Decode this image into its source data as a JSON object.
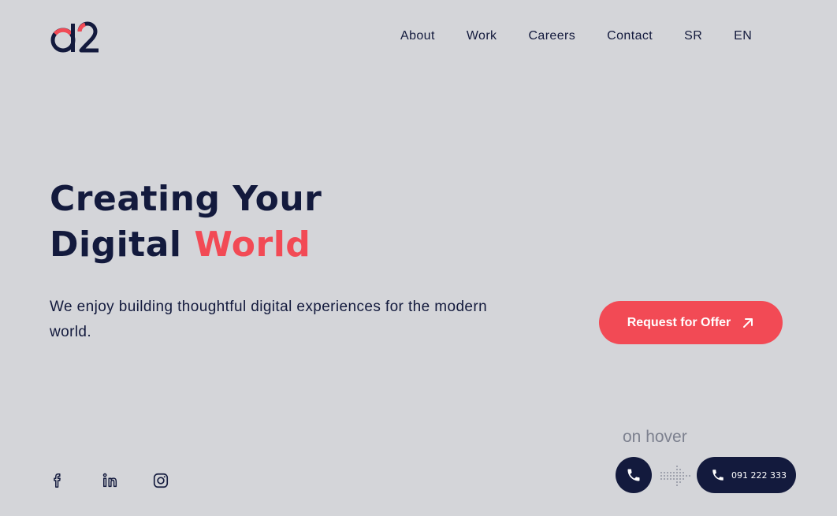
{
  "logo": {
    "text": "d2"
  },
  "nav": {
    "items": [
      "About",
      "Work",
      "Careers",
      "Contact",
      "SR",
      "EN"
    ]
  },
  "hero": {
    "title_line1": "Creating Your",
    "title_line2_plain": "Digital",
    "title_line2_accent": "World",
    "subtitle": "We enjoy building thoughtful digital experiences for the modern world."
  },
  "cta": {
    "label": "Request for Offer"
  },
  "hover_demo": {
    "caption": "on hover",
    "phone_number": "091 222 333"
  },
  "social": {
    "icons": [
      "facebook-icon",
      "linkedin-icon",
      "instagram-icon"
    ]
  },
  "colors": {
    "background": "#d4d5d9",
    "navy": "#131a3d",
    "accent": "#f24a55",
    "muted": "#7d818f"
  }
}
